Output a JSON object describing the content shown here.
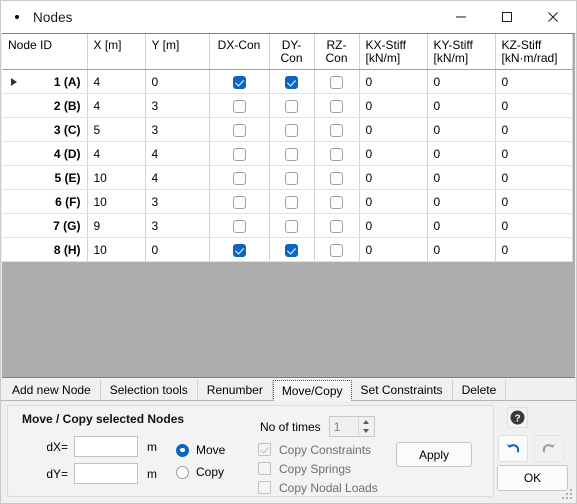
{
  "window": {
    "title": "Nodes",
    "app_icon": "dot-icon",
    "controls": [
      {
        "name": "minimize-button",
        "icon": "minimize-icon"
      },
      {
        "name": "maximize-button",
        "icon": "maximize-icon"
      },
      {
        "name": "close-button",
        "icon": "close-icon"
      }
    ]
  },
  "table": {
    "columns": [
      {
        "label": "Node ID",
        "unit": ""
      },
      {
        "label": "X [m]",
        "unit": ""
      },
      {
        "label": "Y [m]",
        "unit": ""
      },
      {
        "label": "DX-Con",
        "unit": ""
      },
      {
        "label": "DY-Con",
        "unit": ""
      },
      {
        "label": "RZ-Con",
        "unit": ""
      },
      {
        "label": "KX-Stiff",
        "unit": "[kN/m]"
      },
      {
        "label": "KY-Stiff",
        "unit": "[kN/m]"
      },
      {
        "label": "KZ-Stiff",
        "unit": "[kN·m/rad]"
      }
    ],
    "selected_cell": {
      "row": 0,
      "column": 1
    },
    "rows": [
      {
        "id": "1 (A)",
        "current": true,
        "x": "4",
        "y": "0",
        "dx": true,
        "dy": true,
        "rz": false,
        "kx": "0",
        "ky": "0",
        "kz": "0"
      },
      {
        "id": "2 (B)",
        "current": false,
        "x": "4",
        "y": "3",
        "dx": false,
        "dy": false,
        "rz": false,
        "kx": "0",
        "ky": "0",
        "kz": "0"
      },
      {
        "id": "3 (C)",
        "current": false,
        "x": "5",
        "y": "3",
        "dx": false,
        "dy": false,
        "rz": false,
        "kx": "0",
        "ky": "0",
        "kz": "0"
      },
      {
        "id": "4 (D)",
        "current": false,
        "x": "4",
        "y": "4",
        "dx": false,
        "dy": false,
        "rz": false,
        "kx": "0",
        "ky": "0",
        "kz": "0"
      },
      {
        "id": "5 (E)",
        "current": false,
        "x": "10",
        "y": "4",
        "dx": false,
        "dy": false,
        "rz": false,
        "kx": "0",
        "ky": "0",
        "kz": "0"
      },
      {
        "id": "6 (F)",
        "current": false,
        "x": "10",
        "y": "3",
        "dx": false,
        "dy": false,
        "rz": false,
        "kx": "0",
        "ky": "0",
        "kz": "0"
      },
      {
        "id": "7 (G)",
        "current": false,
        "x": "9",
        "y": "3",
        "dx": false,
        "dy": false,
        "rz": false,
        "kx": "0",
        "ky": "0",
        "kz": "0"
      },
      {
        "id": "8 (H)",
        "current": false,
        "x": "10",
        "y": "0",
        "dx": true,
        "dy": true,
        "rz": false,
        "kx": "0",
        "ky": "0",
        "kz": "0"
      }
    ]
  },
  "tabs": [
    {
      "label": "Add new Node",
      "active": false
    },
    {
      "label": "Selection tools",
      "active": false
    },
    {
      "label": "Renumber",
      "active": false
    },
    {
      "label": "Move/Copy",
      "active": true
    },
    {
      "label": "Set Constraints",
      "active": false
    },
    {
      "label": "Delete",
      "active": false
    }
  ],
  "move_copy_panel": {
    "title": "Move / Copy selected Nodes",
    "dx_label": "dX=",
    "dx_value": "",
    "dx_unit": "m",
    "dy_label": "dY=",
    "dy_value": "",
    "dy_unit": "m",
    "mode_options": [
      {
        "label": "Move",
        "selected": true
      },
      {
        "label": "Copy",
        "selected": false
      }
    ],
    "no_of_times_label": "No of times",
    "no_of_times_value": "1",
    "copy_options": [
      {
        "label": "Copy Constraints",
        "checked": true,
        "disabled": true
      },
      {
        "label": "Copy Springs",
        "checked": false,
        "disabled": true
      },
      {
        "label": "Copy Nodal Loads",
        "checked": false,
        "disabled": true
      }
    ],
    "apply_label": "Apply"
  },
  "actions": {
    "help_icon": "question-mark-icon",
    "undo_icon": "undo-arrow-icon",
    "redo_icon": "redo-arrow-icon",
    "ok_label": "OK"
  },
  "colors": {
    "selection_blue": "#0a7ad4",
    "checkbox_blue": "#0a66c2",
    "panel_gray": "#f0f0f0",
    "empty_grid_gray": "#adadad"
  }
}
